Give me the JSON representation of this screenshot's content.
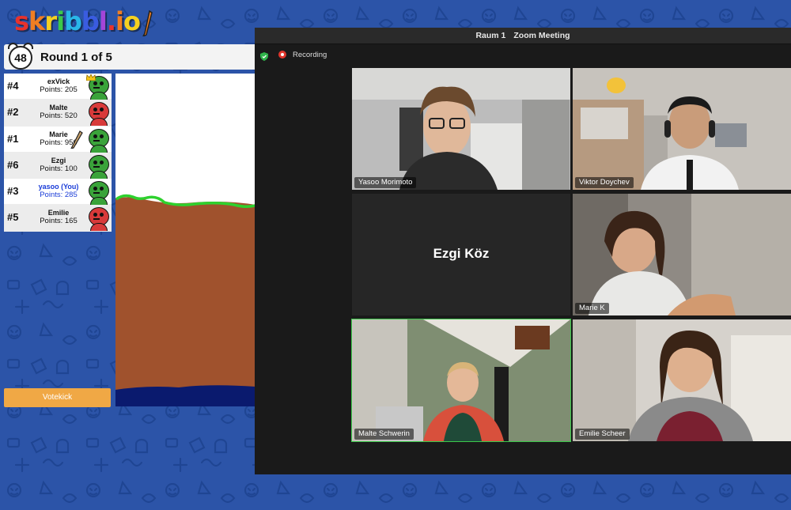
{
  "logo": {
    "text": "skribbl.io",
    "letters": [
      "s",
      "k",
      "r",
      "i",
      "b",
      "b",
      "l",
      ".",
      "i",
      "o"
    ],
    "colors": [
      "#e8322c",
      "#f07e22",
      "#f5d020",
      "#3cc84a",
      "#29b6e8",
      "#3a5ce0",
      "#a445d8",
      "#e8322c",
      "#f07e22",
      "#f5d020"
    ]
  },
  "game": {
    "timer": "48",
    "round_label": "Round 1 of 5",
    "players": [
      {
        "rank": "#4",
        "name": "exVick",
        "points": "Points: 205",
        "avatar_color": "#3aa33a",
        "me": false,
        "crown": true
      },
      {
        "rank": "#2",
        "name": "Malte",
        "points": "Points: 520",
        "avatar_color": "#d83a3a",
        "me": false,
        "crown": false
      },
      {
        "rank": "#1",
        "name": "Marie",
        "points": "Points: 950",
        "avatar_color": "#3aa33a",
        "me": false,
        "crown": false,
        "drawing": true
      },
      {
        "rank": "#6",
        "name": "Ezgi",
        "points": "Points: 100",
        "avatar_color": "#3aa33a",
        "me": false,
        "crown": false
      },
      {
        "rank": "#3",
        "name": "yasoo (You)",
        "points": "Points: 285",
        "avatar_color": "#3aa33a",
        "me": true,
        "crown": false
      },
      {
        "rank": "#5",
        "name": "Emilie",
        "points": "Points: 165",
        "avatar_color": "#d83a3a",
        "me": false,
        "crown": false
      }
    ],
    "votekick_label": "Votekick"
  },
  "zoom": {
    "room": "Raum 1",
    "app_title": "Zoom Meeting",
    "recording_label": "Recording",
    "participants": [
      {
        "name": "Yasoo Morimoto",
        "video": true,
        "active": false
      },
      {
        "name": "Viktor Doychev",
        "video": true,
        "active": false
      },
      {
        "name": "Ezgi Köz",
        "video": false,
        "active": false
      },
      {
        "name": "Marie K",
        "video": true,
        "active": false
      },
      {
        "name": "Malte Schwerin",
        "video": true,
        "active": true
      },
      {
        "name": "Emilie Scheer",
        "video": true,
        "active": false
      }
    ]
  }
}
